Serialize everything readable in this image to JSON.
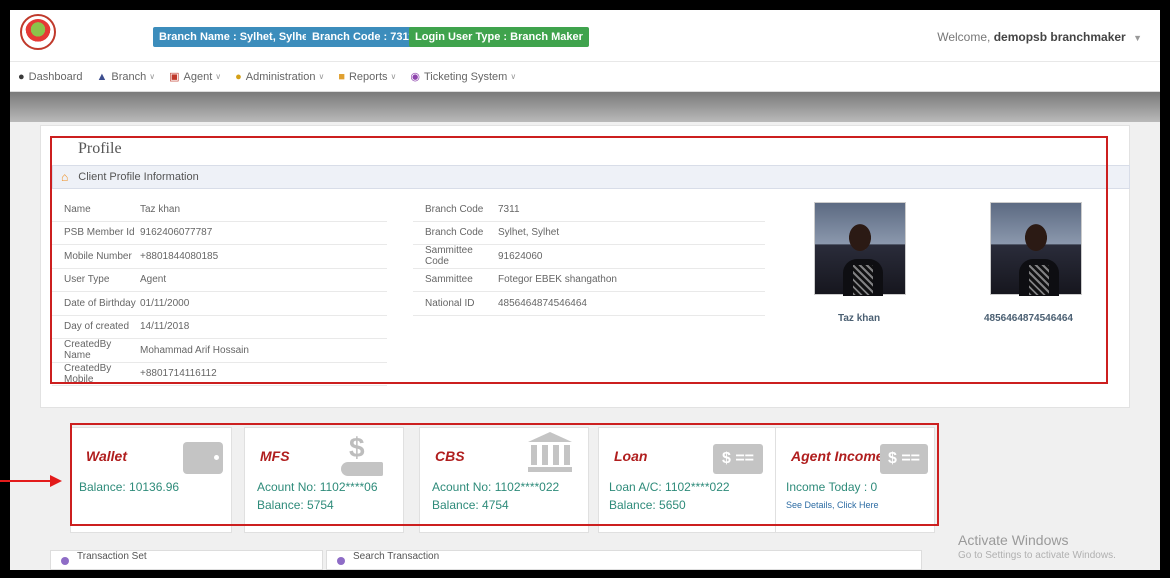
{
  "header": {
    "badges": [
      {
        "text": "Branch Name : Sylhet, Sylhet",
        "color": "#3c8dbc"
      },
      {
        "text": "Branch Code : 7311",
        "color": "#3c8dbc"
      },
      {
        "text": "Login User Type : Branch Maker",
        "color": "#3fa34d"
      }
    ],
    "welcome_prefix": "Welcome,",
    "welcome_user": "demopsb branchmaker"
  },
  "nav": [
    {
      "label": "Dashboard",
      "icon": "dashboard-icon",
      "has_menu": false
    },
    {
      "label": "Branch",
      "icon": "bank-icon",
      "has_menu": true
    },
    {
      "label": "Agent",
      "icon": "cart-icon",
      "has_menu": true
    },
    {
      "label": "Administration",
      "icon": "user-icon",
      "has_menu": true
    },
    {
      "label": "Reports",
      "icon": "file-icon",
      "has_menu": true
    },
    {
      "label": "Ticketing System",
      "icon": "ticket-icon",
      "has_menu": true
    }
  ],
  "profile": {
    "page_title": "Profile",
    "panel_title": "Client Profile Information",
    "left": [
      {
        "k": "Name",
        "v": "Taz khan"
      },
      {
        "k": "PSB Member Id",
        "v": "9162406077787"
      },
      {
        "k": "Mobile Number",
        "v": "+8801844080185"
      },
      {
        "k": "User Type",
        "v": "Agent"
      },
      {
        "k": "Date of Birthday",
        "v": "01/11/2000"
      },
      {
        "k": "Day of created",
        "v": "14/11/2018"
      },
      {
        "k": "CreatedBy Name",
        "v": "Mohammad Arif Hossain"
      },
      {
        "k": "CreatedBy Mobile",
        "v": "+8801714116112"
      }
    ],
    "right": [
      {
        "k": "Branch Code",
        "v": "7311"
      },
      {
        "k": "Branch Code",
        "v": "Sylhet, Sylhet"
      },
      {
        "k": "Sammittee Code",
        "v": "91624060"
      },
      {
        "k": "Sammittee",
        "v": "Fotegor EBEK shangathon"
      },
      {
        "k": "National ID",
        "v": "4856464874546464"
      }
    ],
    "photo1_caption": "Taz khan",
    "photo2_caption": "4856464874546464"
  },
  "cards": {
    "wallet": {
      "title": "Wallet",
      "line1": "Balance: 10136.96"
    },
    "mfs": {
      "title": "MFS",
      "line1": "Acount No: 1102****06",
      "line2": "Balance: 5754"
    },
    "cbs": {
      "title": "CBS",
      "line1": "Acount No: 1102****022",
      "line2": "Balance: 4754"
    },
    "loan": {
      "title": "Loan",
      "line1": "Loan A/C: 1102****022",
      "line2": "Balance: 5650"
    },
    "income": {
      "title": "Agent Income",
      "line1": "Income Today : 0",
      "line2": "See Details, Click Here"
    }
  },
  "bottom": {
    "panel1": "Transaction Set",
    "panel2": "Search Transaction"
  },
  "watermark": {
    "line1": "Activate Windows",
    "line2": "Go to Settings to activate Windows."
  }
}
